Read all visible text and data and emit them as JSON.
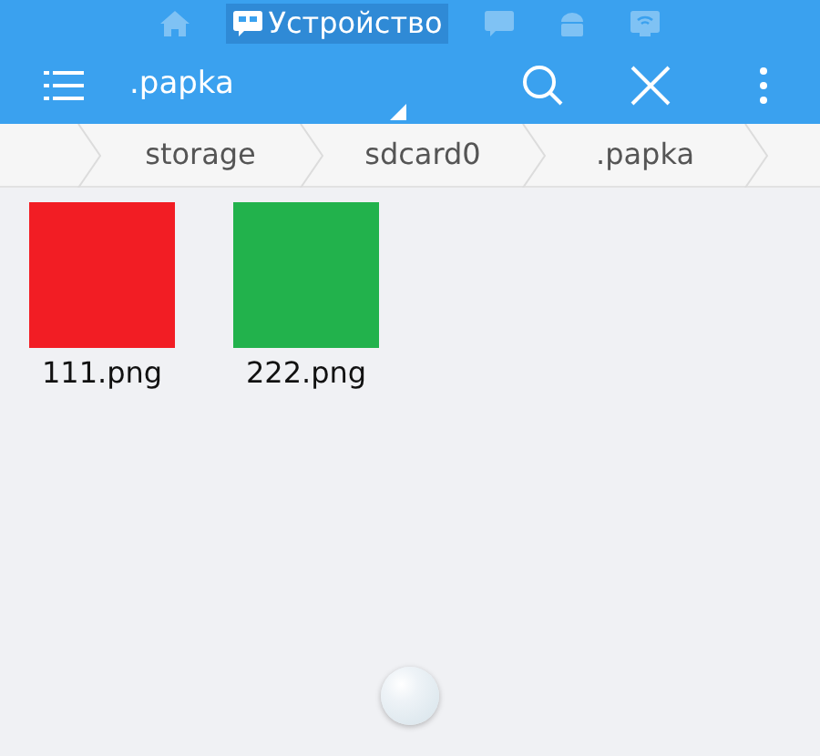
{
  "location_tabs": [
    {
      "kind": "home",
      "selected": false
    },
    {
      "kind": "device",
      "label": "Устройство",
      "selected": true
    },
    {
      "kind": "chat",
      "selected": false
    },
    {
      "kind": "android",
      "selected": false
    },
    {
      "kind": "network",
      "selected": false
    }
  ],
  "toolbar": {
    "title": ".papka"
  },
  "breadcrumbs": [
    {
      "label": "storage"
    },
    {
      "label": "sdcard0"
    },
    {
      "label": ".papka"
    }
  ],
  "files": [
    {
      "name": "111.png",
      "color": "#f21d24"
    },
    {
      "name": "222.png",
      "color": "#22b24c"
    }
  ]
}
